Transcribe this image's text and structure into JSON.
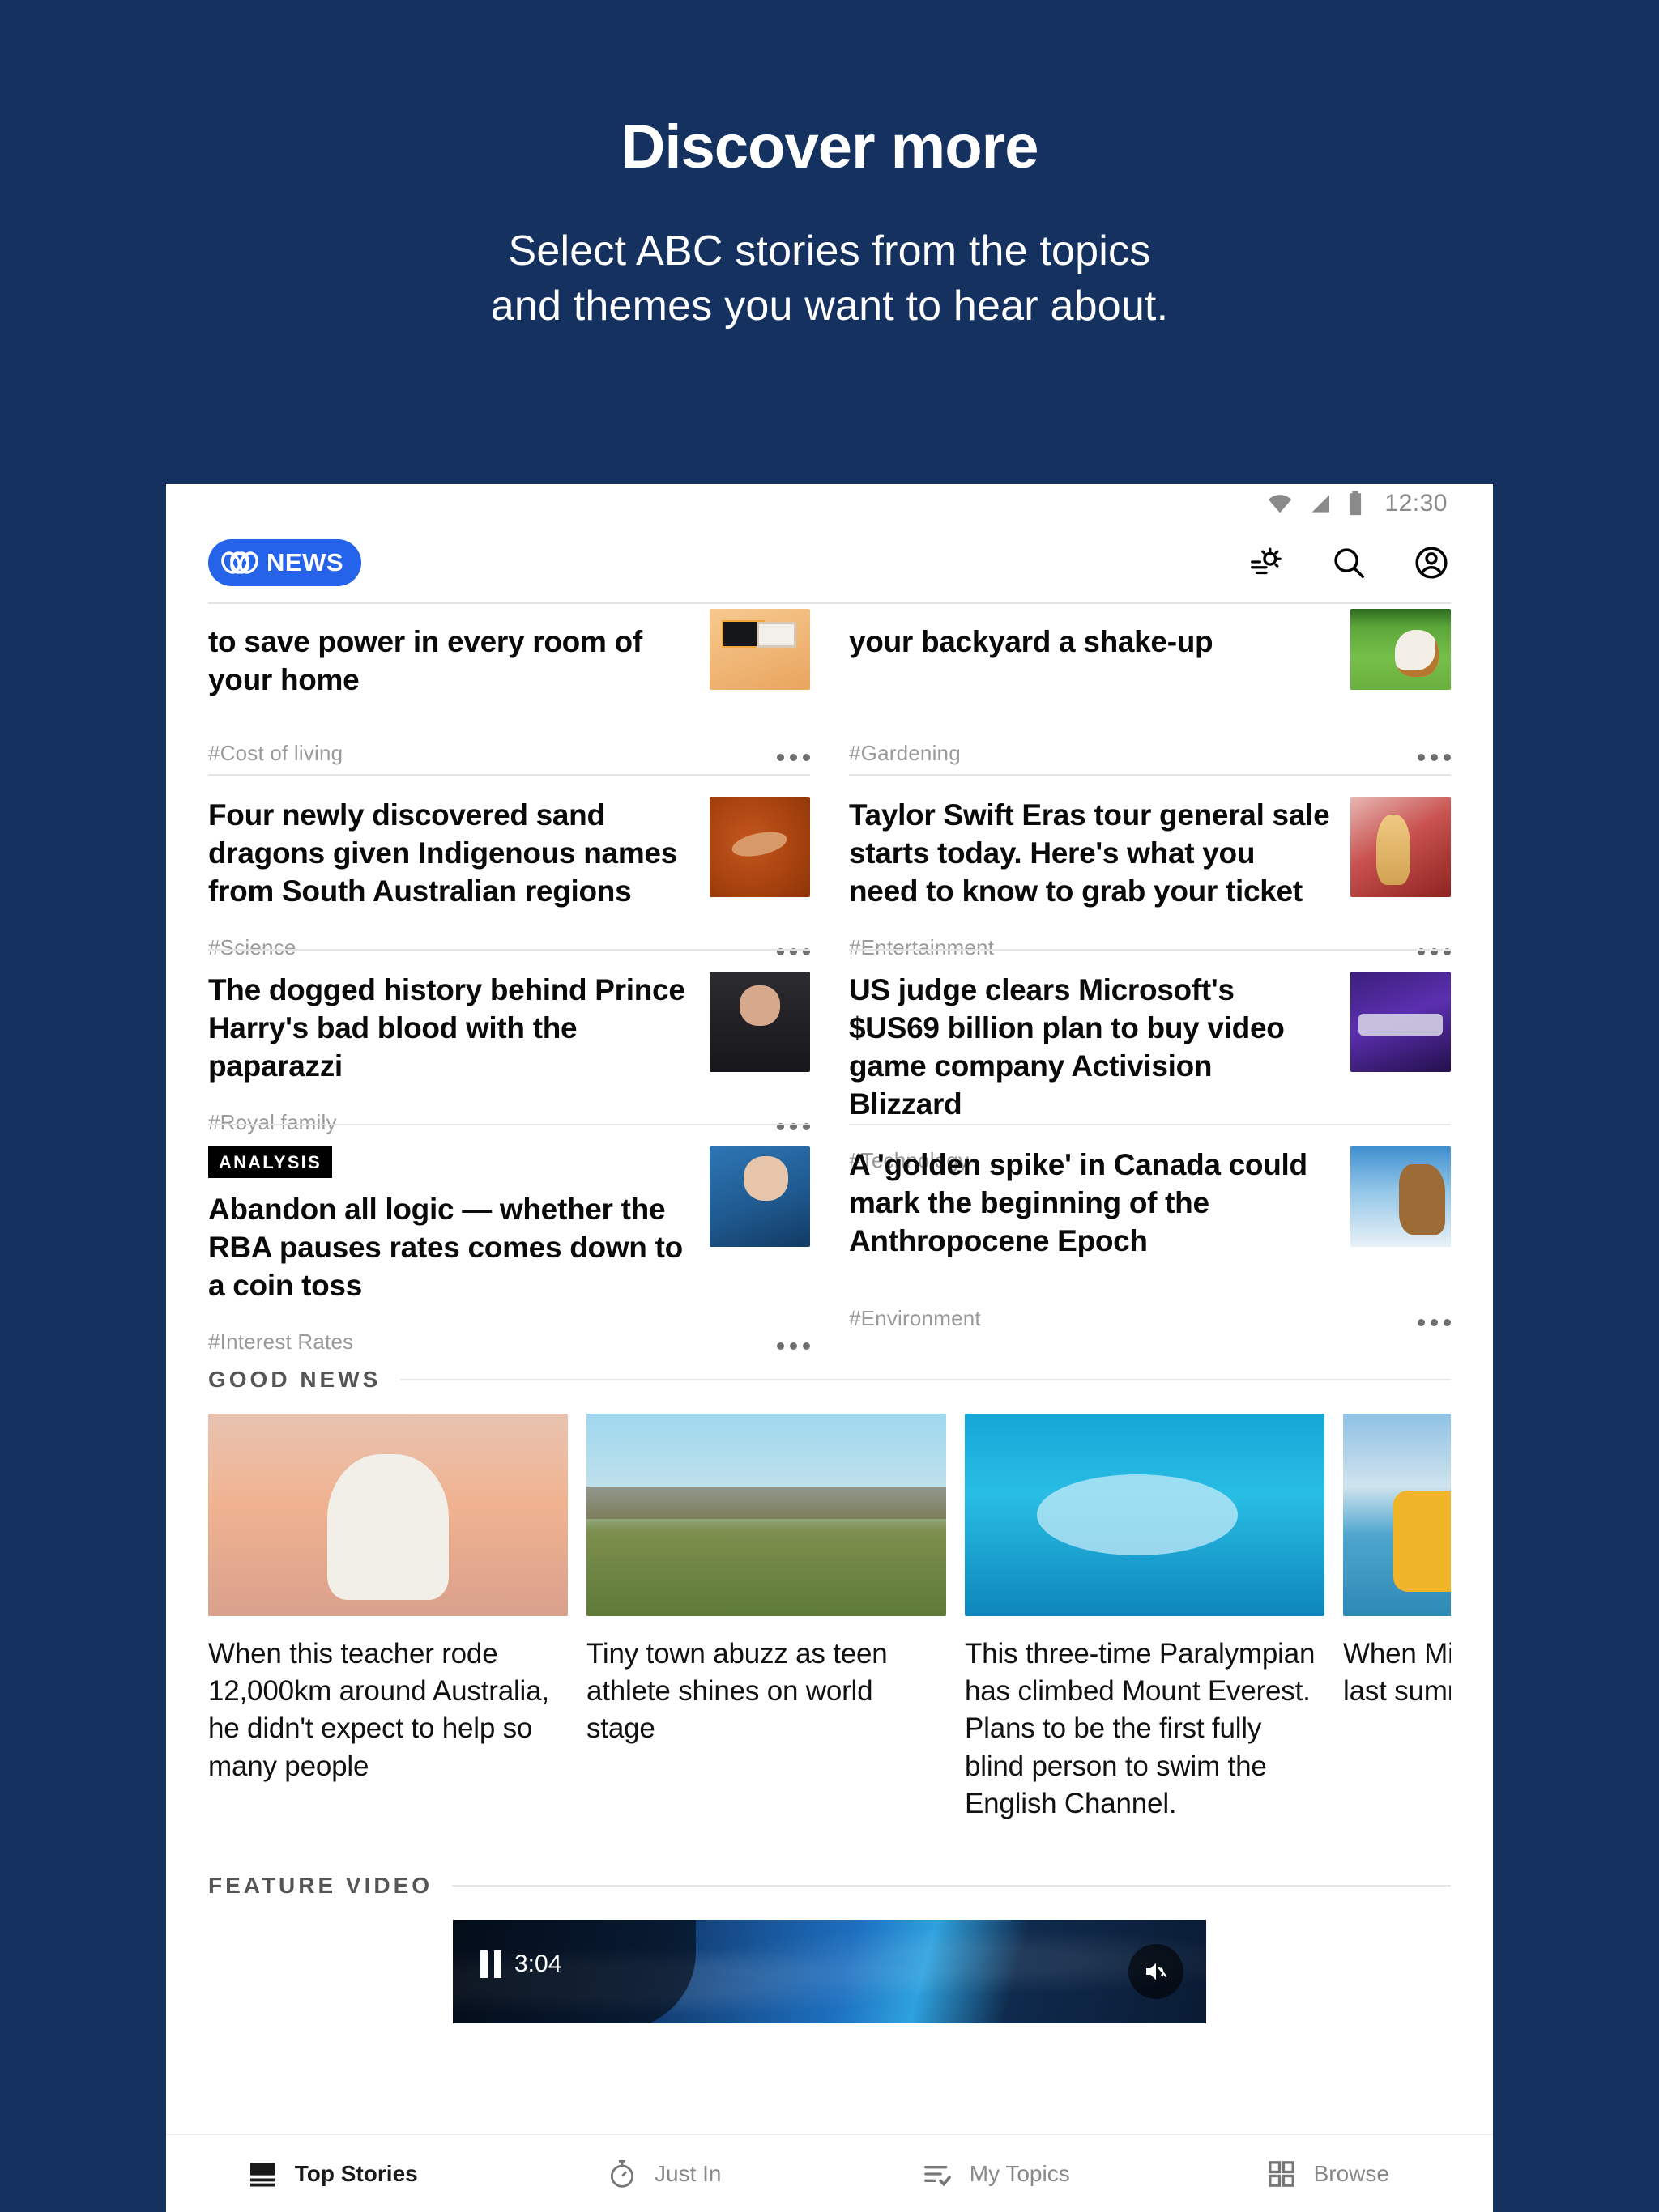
{
  "promo": {
    "title": "Discover more",
    "subtitle_line1": "Select ABC stories from the topics",
    "subtitle_line2": "and themes you want to hear about.",
    "background_color": "#14315f"
  },
  "status_bar": {
    "time": "12:30",
    "icons": [
      "wifi-icon",
      "cellular-signal-icon",
      "battery-icon"
    ]
  },
  "app_header": {
    "logo_text": "NEWS",
    "logo_mark": "abc-lissajous-logo",
    "logo_color": "#2563eb",
    "actions": [
      {
        "name": "weather-icon",
        "label": "Weather"
      },
      {
        "name": "search-icon",
        "label": "Search"
      },
      {
        "name": "account-icon",
        "label": "Account"
      }
    ]
  },
  "feed": {
    "rows": [
      [
        {
          "badge": "",
          "headline": "to save power in every room of your home",
          "topic": "#Cost of living",
          "art": "art-kitchen",
          "clipped_top": true
        },
        {
          "badge": "",
          "headline": "your backyard a shake-up",
          "topic": "#Gardening",
          "art": "art-grass",
          "clipped_top": true
        }
      ],
      [
        {
          "badge": "",
          "headline": "Four newly discovered sand dragons given Indigenous names from South Australian regions",
          "topic": "#Science",
          "art": "art-dirt",
          "clipped_top": false
        },
        {
          "badge": "",
          "headline": "Taylor Swift Eras tour general sale starts today. Here's what you need to know to grab your ticket",
          "topic": "#Entertainment",
          "art": "art-swift",
          "clipped_top": false
        }
      ],
      [
        {
          "badge": "",
          "headline": "The dogged history behind Prince Harry's bad blood with the paparazzi",
          "topic": "#Royal family",
          "art": "art-harry",
          "clipped_top": false
        },
        {
          "badge": "",
          "headline": "US judge clears Microsoft's $US69 billion plan to buy video game company Activision Blizzard",
          "topic": "#Technology",
          "art": "art-blizzard",
          "clipped_top": false
        }
      ],
      [
        {
          "badge": "ANALYSIS",
          "headline": "Abandon all logic — whether the RBA pauses rates comes down to a coin toss",
          "topic": "#Interest Rates",
          "art": "art-rba",
          "clipped_top": false
        },
        {
          "badge": "",
          "headline": "A 'golden spike' in Canada could mark the beginning of the Anthropocene Epoch",
          "topic": "#Environment",
          "art": "art-ice",
          "clipped_top": false
        }
      ]
    ]
  },
  "good_news": {
    "section_title": "GOOD NEWS",
    "cards": [
      {
        "caption": "When this teacher rode 12,000km around Australia, he didn't expect to help so many people",
        "art": "art-cyclist"
      },
      {
        "caption": "Tiny town abuzz as teen athlete shines on world stage",
        "art": "art-field"
      },
      {
        "caption": "This three-time Paralympian has climbed Mount Everest. Plans to be the first fully blind person to swim the English Channel.",
        "art": "art-pool"
      },
      {
        "caption": "When Micha due to lifegu last summer to act",
        "art": "art-lifeguard"
      }
    ]
  },
  "feature_video": {
    "section_title": "FEATURE VIDEO",
    "duration": "3:04",
    "play_state_icon": "pause-icon",
    "volume_icon": "mute-icon"
  },
  "bottom_nav": {
    "items": [
      {
        "label": "Top Stories",
        "icon": "top-stories-icon",
        "active": true
      },
      {
        "label": "Just In",
        "icon": "stopwatch-icon",
        "active": false
      },
      {
        "label": "My Topics",
        "icon": "my-topics-icon",
        "active": false
      },
      {
        "label": "Browse",
        "icon": "grid-icon",
        "active": false
      }
    ]
  }
}
